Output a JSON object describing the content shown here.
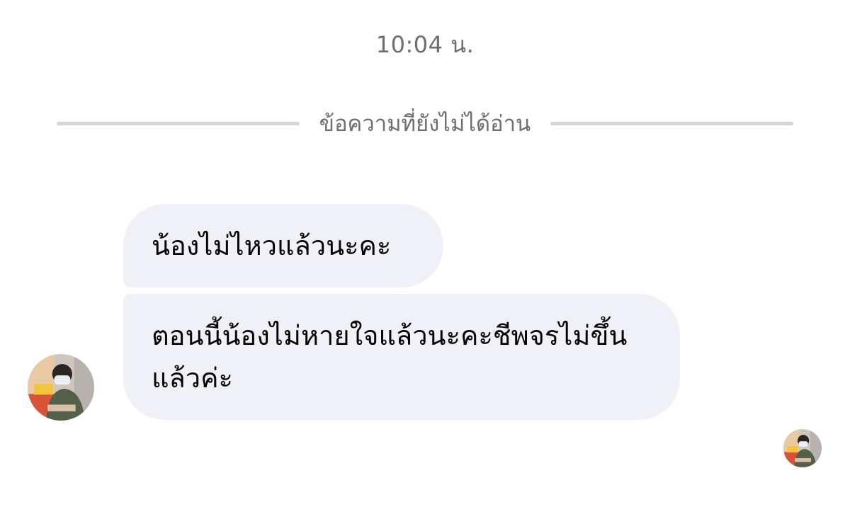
{
  "chat": {
    "timestamp": "10:04 น.",
    "unread_divider": "ข้อความที่ยังไม่ได้อ่าน",
    "messages": [
      {
        "text": "น้องไม่ไหวแล้วนะคะ"
      },
      {
        "text": "ตอนนี้น้องไม่หายใจแล้วนะคะชีพจรไม่ขึ้นแล้วค่ะ"
      }
    ]
  },
  "colors": {
    "bubble_background": "#f0f1f6",
    "secondary_text": "#6b6e73",
    "divider_line": "#d3d4da"
  },
  "icons": {
    "sender_avatar": "user-photo-avatar",
    "read_receipt": "read-receipt-avatar"
  }
}
